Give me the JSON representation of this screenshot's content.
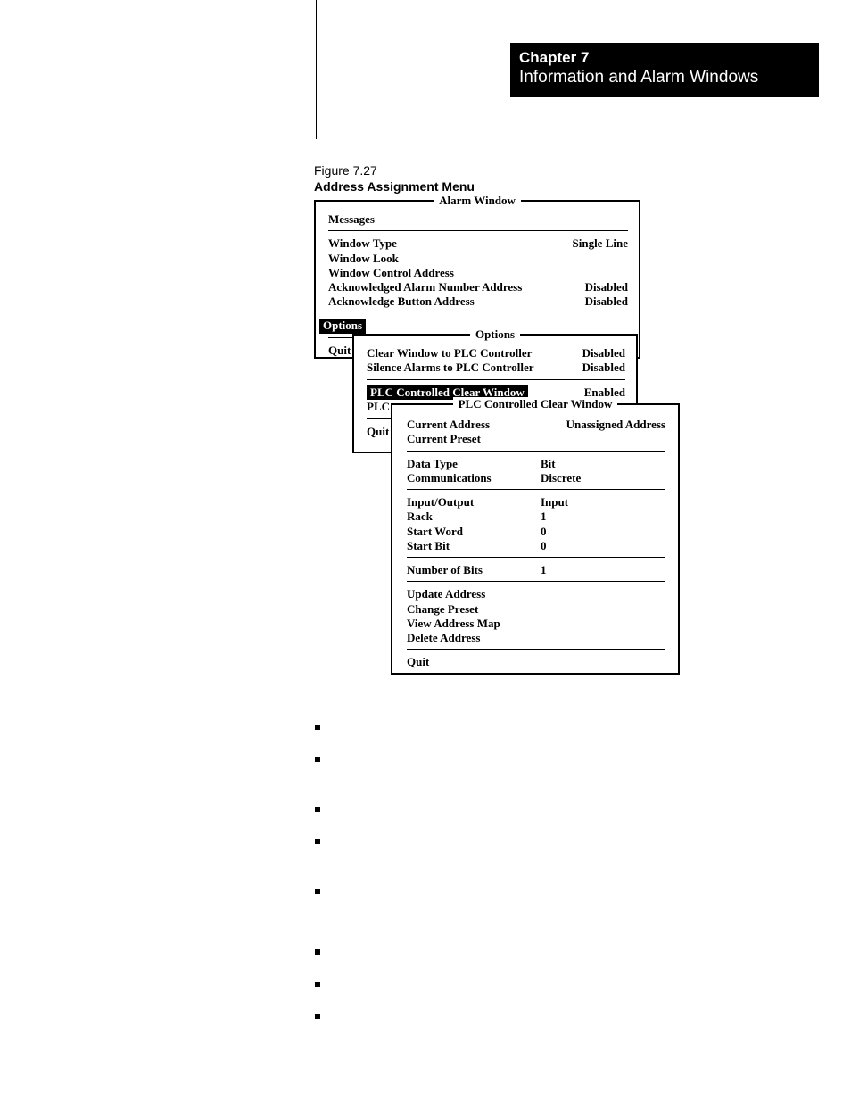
{
  "header": {
    "chapter": "Chapter 7",
    "title": "Information and Alarm Windows"
  },
  "figure": {
    "number": "Figure 7.27",
    "caption": "Address Assignment Menu"
  },
  "alarm_window": {
    "title": "Alarm Window",
    "messages_label": "Messages",
    "rows": [
      {
        "label": "Window Type",
        "value": "Single Line"
      },
      {
        "label": "Window Look",
        "value": ""
      },
      {
        "label": "Window Control Address",
        "value": ""
      },
      {
        "label": "Acknowledged Alarm Number Address",
        "value": "Disabled"
      },
      {
        "label": "Acknowledge Button Address",
        "value": "Disabled"
      }
    ],
    "options_label": "Options",
    "quit_label": "Quit"
  },
  "options_window": {
    "title": "Options",
    "rows": [
      {
        "label": "Clear Window to PLC Controller",
        "value": "Disabled"
      },
      {
        "label": "Silence Alarms to PLC Controller",
        "value": "Disabled"
      }
    ],
    "highlight": {
      "label": "PLC Controlled Clear Window",
      "value": "Enabled"
    },
    "plc_partial": "PLC",
    "quit_label": "Quit"
  },
  "plc_window": {
    "title": "PLC Controlled Clear Window",
    "group1": [
      {
        "label": "Current Address",
        "value": "Unassigned Address"
      },
      {
        "label": "Current Preset",
        "value": ""
      }
    ],
    "group2": [
      {
        "label": "Data Type",
        "value": "Bit"
      },
      {
        "label": "Communications",
        "value": "Discrete"
      }
    ],
    "group3": [
      {
        "label": "Input/Output",
        "value": "Input"
      },
      {
        "label": "Rack",
        "value": "1"
      },
      {
        "label": "Start Word",
        "value": "0"
      },
      {
        "label": "Start Bit",
        "value": "0"
      }
    ],
    "group4": [
      {
        "label": "Number of Bits",
        "value": "1"
      }
    ],
    "actions": [
      "Update Address",
      "Change Preset",
      "View Address Map",
      "Delete Address"
    ],
    "quit_label": "Quit"
  }
}
